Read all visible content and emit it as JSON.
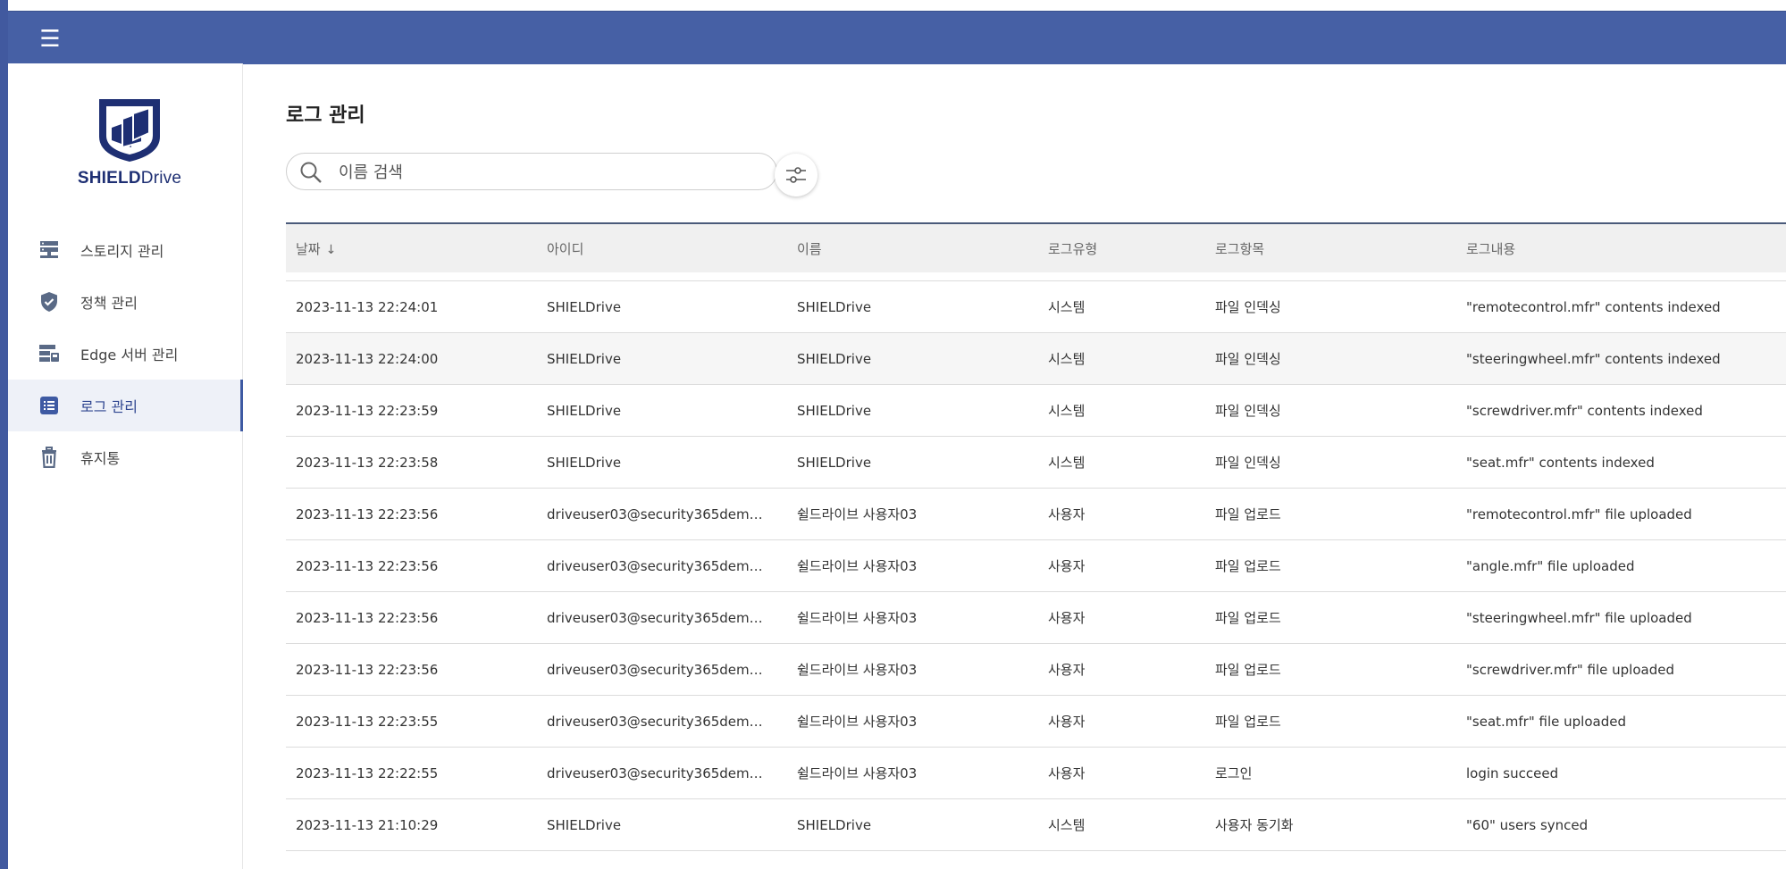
{
  "topbar": {
    "menu_icon": "hamburger-icon"
  },
  "brand": {
    "name_bold": "SHIELD",
    "name_light": "rive",
    "name_d": "D",
    "logo_color": "#1e2f73"
  },
  "nav": [
    {
      "label": "스토리지 관리",
      "icon": "server-icon"
    },
    {
      "label": "정책 관리",
      "icon": "shield-check-icon"
    },
    {
      "label": "Edge 서버 관리",
      "icon": "edge-server-icon"
    },
    {
      "label": "로그 관리",
      "icon": "log-list-icon",
      "active": true
    },
    {
      "label": "휴지통",
      "icon": "trash-icon"
    }
  ],
  "page": {
    "title": "로그 관리"
  },
  "search": {
    "placeholder": "이름 검색"
  },
  "table": {
    "headers": [
      "날짜",
      "아이디",
      "이름",
      "로그유형",
      "로그항목",
      "로그내용"
    ],
    "sort_indicator": "↓",
    "rows": [
      [
        "2023-11-13 22:24:01",
        "SHIELDrive",
        "SHIELDrive",
        "시스템",
        "파일 인덱싱",
        "\"remotecontrol.mfr\" contents indexed"
      ],
      [
        "2023-11-13 22:24:00",
        "SHIELDrive",
        "SHIELDrive",
        "시스템",
        "파일 인덱싱",
        "\"steeringwheel.mfr\" contents indexed"
      ],
      [
        "2023-11-13 22:23:59",
        "SHIELDrive",
        "SHIELDrive",
        "시스템",
        "파일 인덱싱",
        "\"screwdriver.mfr\" contents indexed"
      ],
      [
        "2023-11-13 22:23:58",
        "SHIELDrive",
        "SHIELDrive",
        "시스템",
        "파일 인덱싱",
        "\"seat.mfr\" contents indexed"
      ],
      [
        "2023-11-13 22:23:56",
        "driveuser03@security365dem…",
        "쉴드라이브 사용자03",
        "사용자",
        "파일 업로드",
        "\"remotecontrol.mfr\" file uploaded"
      ],
      [
        "2023-11-13 22:23:56",
        "driveuser03@security365dem…",
        "쉴드라이브 사용자03",
        "사용자",
        "파일 업로드",
        "\"angle.mfr\" file uploaded"
      ],
      [
        "2023-11-13 22:23:56",
        "driveuser03@security365dem…",
        "쉴드라이브 사용자03",
        "사용자",
        "파일 업로드",
        "\"steeringwheel.mfr\" file uploaded"
      ],
      [
        "2023-11-13 22:23:56",
        "driveuser03@security365dem…",
        "쉴드라이브 사용자03",
        "사용자",
        "파일 업로드",
        "\"screwdriver.mfr\" file uploaded"
      ],
      [
        "2023-11-13 22:23:55",
        "driveuser03@security365dem…",
        "쉴드라이브 사용자03",
        "사용자",
        "파일 업로드",
        "\"seat.mfr\" file uploaded"
      ],
      [
        "2023-11-13 22:22:55",
        "driveuser03@security365dem…",
        "쉴드라이브 사용자03",
        "사용자",
        "로그인",
        "login succeed"
      ],
      [
        "2023-11-13 21:10:29",
        "SHIELDrive",
        "SHIELDrive",
        "시스템",
        "사용자 동기화",
        "\"60\" users synced"
      ]
    ]
  },
  "colors": {
    "topbar": "#4660a5",
    "accent": "#3e5aa3",
    "header_bg": "#f0f0f0"
  }
}
